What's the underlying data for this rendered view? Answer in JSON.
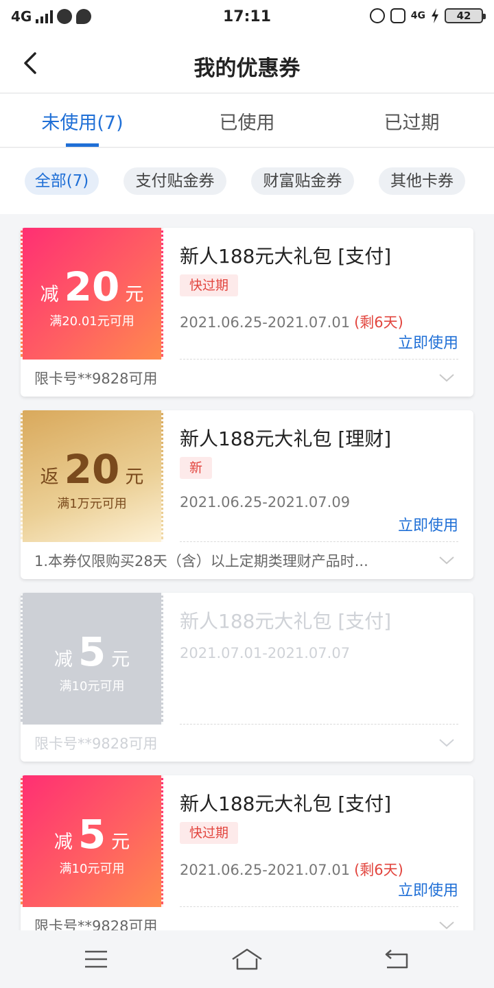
{
  "status_bar": {
    "network": "4G",
    "time": "17:11",
    "net_right": "4G",
    "battery": "42"
  },
  "header": {
    "title": "我的优惠券"
  },
  "tabs": [
    {
      "label": "未使用(7)",
      "active": true
    },
    {
      "label": "已使用",
      "active": false
    },
    {
      "label": "已过期",
      "active": false
    }
  ],
  "filters": [
    {
      "label": "全部(7)",
      "active": true
    },
    {
      "label": "支付贴金券",
      "active": false
    },
    {
      "label": "财富贴金券",
      "active": false
    },
    {
      "label": "其他卡券",
      "active": false
    }
  ],
  "coupons": [
    {
      "style": "pink",
      "prefix": "减",
      "amount": "20",
      "unit": "元",
      "condition": "满20.01元可用",
      "name": "新人188元大礼包  [支付]",
      "tag": "快过期",
      "date": "2021.06.25-2021.07.01",
      "remaining": "(剩6天)",
      "action": "立即使用",
      "footer": "限卡号**9828可用"
    },
    {
      "style": "gold",
      "prefix": "返",
      "amount": "20",
      "unit": "元",
      "condition": "满1万元可用",
      "name": "新人188元大礼包  [理财]",
      "tag": "新",
      "date": "2021.06.25-2021.07.09",
      "remaining": "",
      "action": "立即使用",
      "footer": "1.本券仅限购买28天（含）以上定期类理财产品时..."
    },
    {
      "style": "gray",
      "prefix": "减",
      "amount": "5",
      "unit": "元",
      "condition": "满10元可用",
      "name": "新人188元大礼包  [支付]",
      "tag": "",
      "date": "2021.07.01-2021.07.07",
      "remaining": "",
      "action": "",
      "footer": "限卡号**9828可用"
    },
    {
      "style": "pink",
      "prefix": "减",
      "amount": "5",
      "unit": "元",
      "condition": "满10元可用",
      "name": "新人188元大礼包  [支付]",
      "tag": "快过期",
      "date": "2021.06.25-2021.07.01",
      "remaining": "(剩6天)",
      "action": "立即使用",
      "footer": "限卡号**9828可用"
    }
  ],
  "colors": {
    "accent": "#1f6fd6",
    "warning": "#e2453e",
    "pink_start": "#ff2f73",
    "pink_end": "#ff8a4e",
    "gold_start": "#d9a95c",
    "gray_stub": "#cdd0d6"
  },
  "icons": {
    "back": "chevron-left-icon",
    "expand": "chevron-down-icon",
    "nav_menu": "menu-icon",
    "nav_home": "home-icon",
    "nav_back": "back-arrow-icon"
  }
}
